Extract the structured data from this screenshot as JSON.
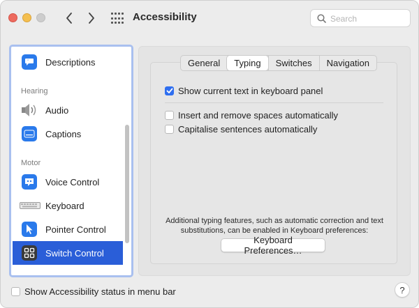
{
  "window": {
    "title": "Accessibility",
    "search_placeholder": "Search"
  },
  "sidebar": {
    "items": [
      {
        "label": "Descriptions",
        "icon": "speech-bubble-icon"
      },
      {
        "header": "Hearing"
      },
      {
        "label": "Audio",
        "icon": "speaker-icon"
      },
      {
        "label": "Captions",
        "icon": "captions-icon"
      },
      {
        "header": "Motor"
      },
      {
        "label": "Voice Control",
        "icon": "voice-control-icon"
      },
      {
        "label": "Keyboard",
        "icon": "keyboard-icon"
      },
      {
        "label": "Pointer Control",
        "icon": "pointer-icon"
      },
      {
        "label": "Switch Control",
        "icon": "switch-control-icon",
        "selected": true
      }
    ]
  },
  "tabs": [
    {
      "label": "General"
    },
    {
      "label": "Typing",
      "active": true
    },
    {
      "label": "Switches"
    },
    {
      "label": "Navigation"
    }
  ],
  "options": [
    {
      "label": "Show current text in keyboard panel",
      "checked": true
    },
    {
      "label": "Insert and remove spaces automatically",
      "checked": false
    },
    {
      "label": "Capitalise sentences automatically",
      "checked": false
    }
  ],
  "info_text": "Additional typing features, such as automatic correction and text substitutions, can be enabled in Keyboard preferences:",
  "keyboard_button": "Keyboard Preferences…",
  "status_checkbox": {
    "label": "Show Accessibility status in menu bar",
    "checked": false
  },
  "help_label": "?",
  "colors": {
    "accent": "#2a5ed8",
    "checkbox": "#2f6ff0"
  }
}
